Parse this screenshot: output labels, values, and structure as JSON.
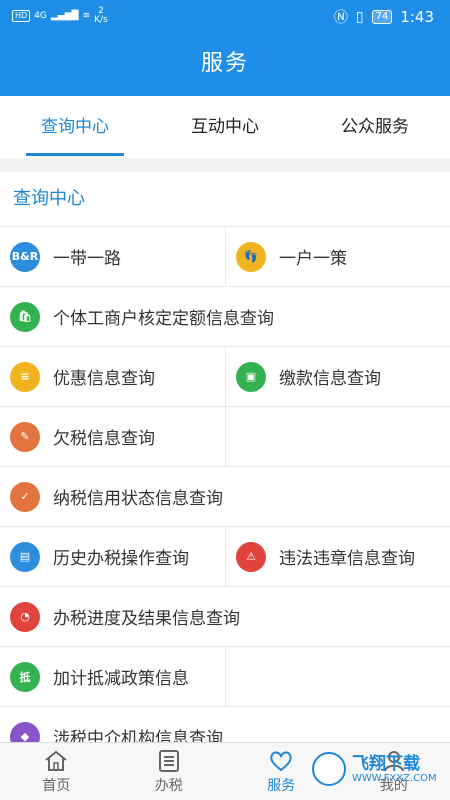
{
  "status": {
    "badge": "HD",
    "signal": "4G",
    "net_rate": "2",
    "net_unit": "K/s",
    "battery": "74",
    "time": "1:43"
  },
  "header": {
    "title": "服务"
  },
  "tabs": [
    {
      "label": "查询中心",
      "active": true
    },
    {
      "label": "互动中心",
      "active": false
    },
    {
      "label": "公众服务",
      "active": false
    }
  ],
  "section": {
    "title": "查询中心"
  },
  "items": [
    {
      "label": "一带一路",
      "icon": "belt-road-icon",
      "glyph": "B&R",
      "color": "#2d8ee0"
    },
    {
      "label": "一户一策",
      "icon": "footprint-icon",
      "glyph": "👣",
      "color": "#f2b321"
    },
    {
      "label": "个体工商户核定定额信息查询",
      "icon": "shop-icon",
      "glyph": "🛍",
      "color": "#34b24f"
    },
    {
      "label": "优惠信息查询",
      "icon": "discount-icon",
      "glyph": "≡",
      "color": "#f2b321"
    },
    {
      "label": "缴款信息查询",
      "icon": "wallet-icon",
      "glyph": "▣",
      "color": "#34b24f"
    },
    {
      "label": "欠税信息查询",
      "icon": "arrears-icon",
      "glyph": "✎",
      "color": "#e3743d"
    },
    {
      "label": "纳税信用状态信息查询",
      "icon": "credit-icon",
      "glyph": "✓",
      "color": "#e3743d"
    },
    {
      "label": "历史办税操作查询",
      "icon": "history-icon",
      "glyph": "▤",
      "color": "#2d8ee0"
    },
    {
      "label": "违法违章信息查询",
      "icon": "violation-icon",
      "glyph": "⚠",
      "color": "#e0443c"
    },
    {
      "label": "办税进度及结果信息查询",
      "icon": "progress-icon",
      "glyph": "◔",
      "color": "#e0443c"
    },
    {
      "label": "加计抵减政策信息",
      "icon": "deduction-icon",
      "glyph": "抵",
      "color": "#34b24f"
    },
    {
      "label": "涉税中介机构信息查询",
      "icon": "agency-icon",
      "glyph": "◆",
      "color": "#8a55c8"
    }
  ],
  "bottomnav": [
    {
      "label": "首页",
      "icon": "home-icon",
      "active": false
    },
    {
      "label": "办税",
      "icon": "list-icon",
      "active": false
    },
    {
      "label": "服务",
      "icon": "heart-icon",
      "active": true
    },
    {
      "label": "我的",
      "icon": "user-icon",
      "active": false
    }
  ],
  "watermark": {
    "title": "飞翔下载",
    "url": "WWW.FXXZ.COM"
  }
}
